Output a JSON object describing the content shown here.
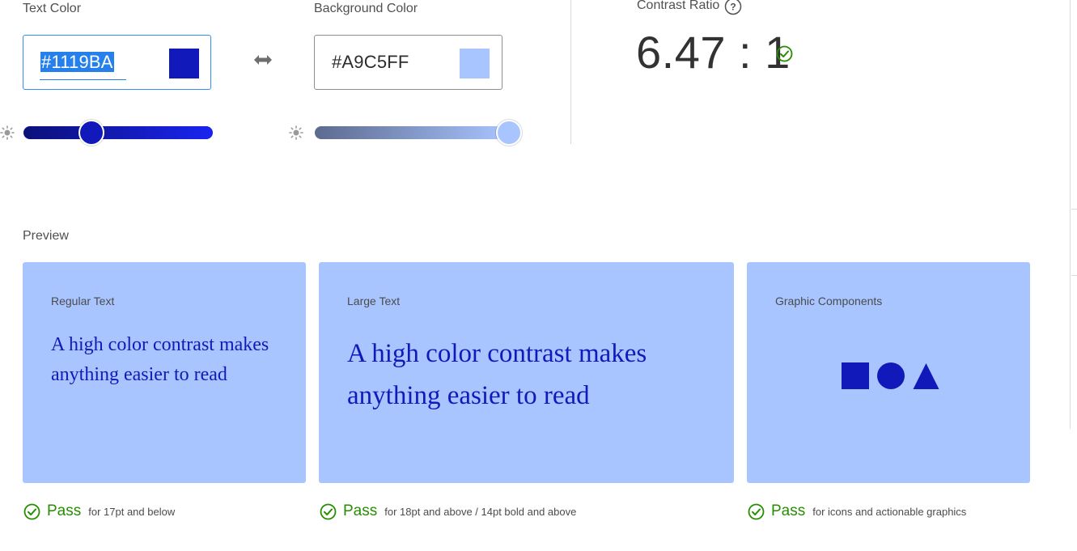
{
  "text_color": {
    "label": "Text Color",
    "hex_value": "#1119BA",
    "swatch_color": "#1119BA",
    "slider_level": 0.36
  },
  "swap": {
    "icon": "swap-arrows-icon"
  },
  "background_color": {
    "label": "Background Color",
    "hex_value": "#A9C5FF",
    "swatch_color": "#A9C5FF",
    "slider_level": 1.0
  },
  "contrast": {
    "label": "Contrast Ratio",
    "help_icon": "question-circle-icon",
    "value": "6.47 : 1",
    "status_icon": "check-circle-icon"
  },
  "preview": {
    "label": "Preview",
    "cards": [
      {
        "title": "Regular Text",
        "sample": "A high color contrast makes anything easier to read",
        "result": "Pass",
        "note": "for 17pt and below"
      },
      {
        "title": "Large Text",
        "sample": "A high color contrast makes anything easier to read",
        "result": "Pass",
        "note": "for 18pt and above / 14pt bold and above"
      },
      {
        "title": "Graphic Components",
        "sample": "",
        "result": "Pass",
        "note": "for icons and actionable graphics"
      }
    ]
  },
  "colors": {
    "pass_green": "#268E00",
    "focus_blue": "#378EF0"
  }
}
